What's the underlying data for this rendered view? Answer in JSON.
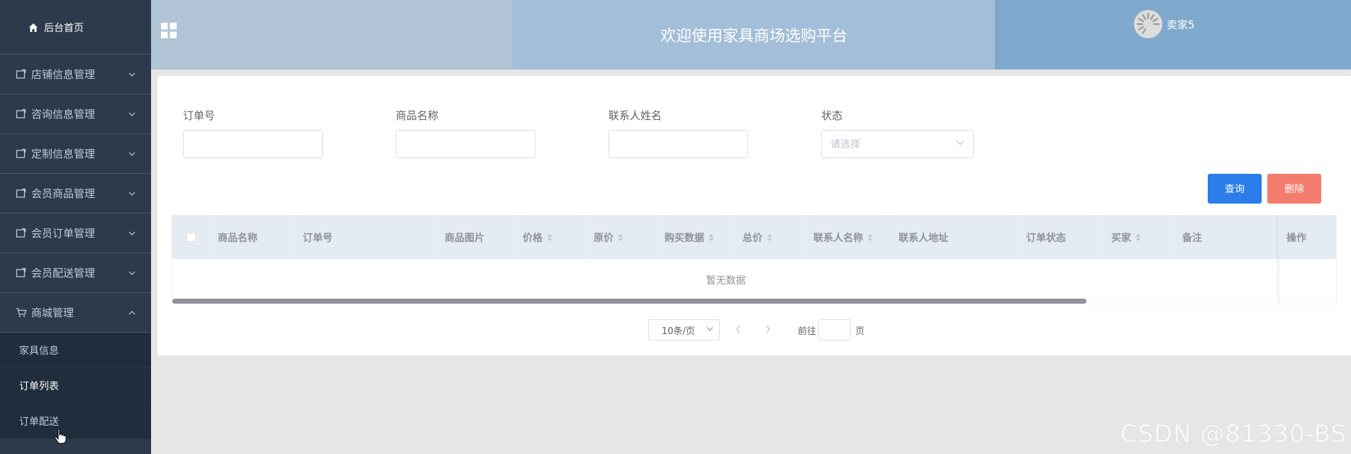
{
  "sidebar": {
    "home_label": "后台首页",
    "menus": [
      {
        "label": "店铺信息管理"
      },
      {
        "label": "咨询信息管理"
      },
      {
        "label": "定制信息管理"
      },
      {
        "label": "会员商品管理"
      },
      {
        "label": "会员订单管理"
      },
      {
        "label": "会员配送管理"
      }
    ],
    "mall_menu": {
      "label": "商城管理",
      "items": [
        {
          "label": "家具信息",
          "active": false
        },
        {
          "label": "订单列表",
          "active": true
        },
        {
          "label": "订单配送",
          "active": false
        }
      ]
    }
  },
  "header": {
    "title": "欢迎使用家具商场选购平台",
    "user_name": "卖家5"
  },
  "filters": {
    "order_no_label": "订单号",
    "product_name_label": "商品名称",
    "contact_name_label": "联系人姓名",
    "status_label": "状态",
    "status_placeholder": "请选择"
  },
  "buttons": {
    "query": "查询",
    "delete": "删除"
  },
  "table": {
    "columns": [
      "商品名称",
      "订单号",
      "商品图片",
      "价格",
      "原价",
      "购买数据",
      "总价",
      "联系人名称",
      "联系人地址",
      "订单状态",
      "买家",
      "备注"
    ],
    "fixed_column": "操作",
    "empty_text": "暂无数据"
  },
  "pagination": {
    "page_size": "10条/页",
    "goto_prefix": "前往",
    "goto_suffix": "页"
  },
  "watermark": "CSDN @81330-BS",
  "colors": {
    "sidebar_bg": "#2d3a4b",
    "primary": "#2b7de9",
    "danger": "#f47c6c"
  }
}
